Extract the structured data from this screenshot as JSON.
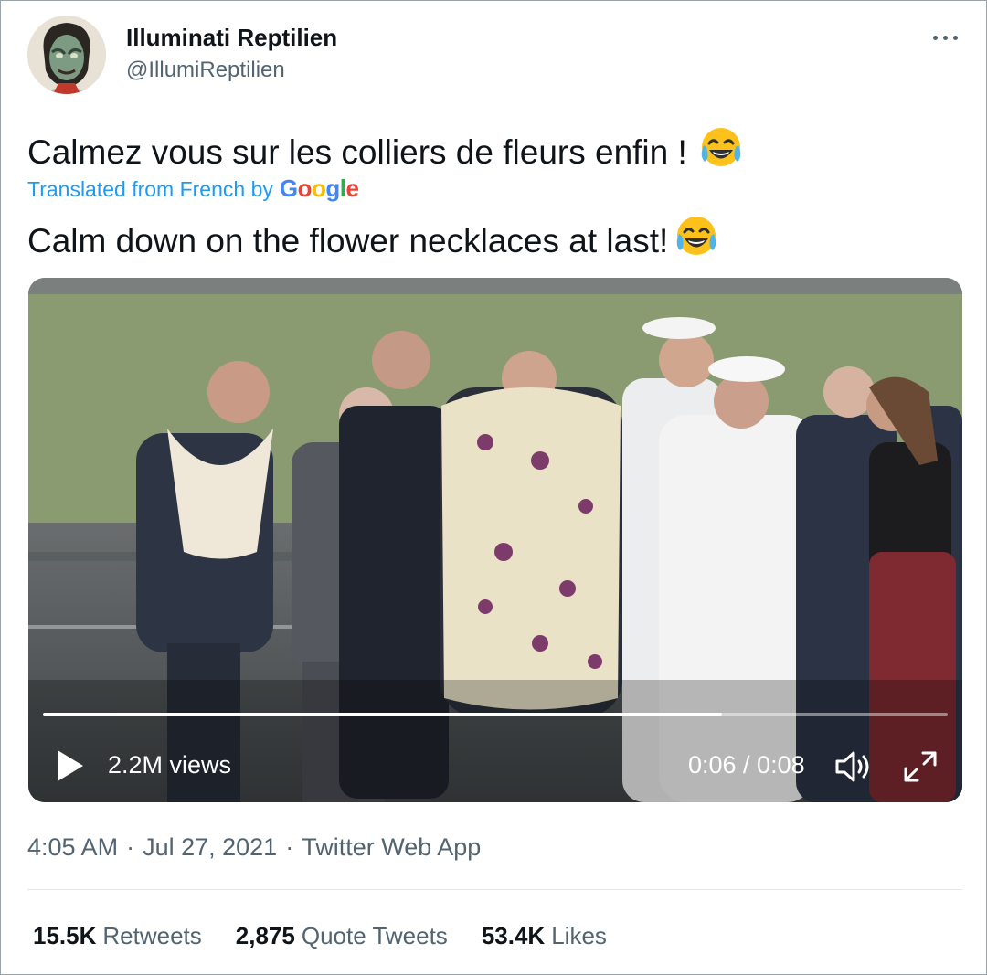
{
  "author": {
    "display_name": "Illuminati Reptilien",
    "handle": "@IllumiReptilien",
    "more_icon": "more-horizontal-icon"
  },
  "tweet": {
    "text": "Calmez vous sur les colliers de fleurs enfin !",
    "emoji": "😂",
    "translated_label": "Translated from French by",
    "translator": {
      "G": "G",
      "o1": "o",
      "o2": "o",
      "g": "g",
      "l": "l",
      "e": "e"
    },
    "translation": "Calm down on the flower necklaces at last!"
  },
  "video": {
    "views": "2.2M views",
    "time": "0:06 / 0:08",
    "progress": 0.75,
    "icons": [
      "play-icon",
      "volume-icon",
      "fullscreen-icon"
    ]
  },
  "meta": {
    "time": "4:05 AM",
    "separator": "·",
    "date": "Jul 27, 2021",
    "source": "Twitter Web App"
  },
  "stats": {
    "retweets_count": "15.5K",
    "retweets_label": "Retweets",
    "quotes_count": "2,875",
    "quotes_label": "Quote Tweets",
    "likes_count": "53.4K",
    "likes_label": "Likes"
  },
  "colors": {
    "text": "#0f1419",
    "secondary": "#536471",
    "link": "#1d9bf0",
    "google_blue": "#4285f4",
    "google_red": "#ea4335",
    "google_yellow": "#fbbc05",
    "google_green": "#34a853"
  }
}
